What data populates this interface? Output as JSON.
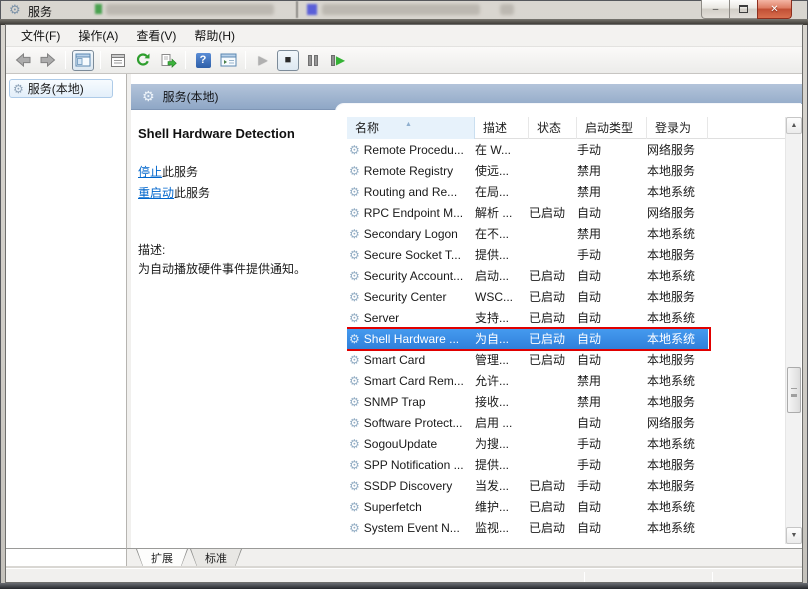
{
  "titlebar": {
    "app_title": "服务"
  },
  "window_controls": {
    "minimize": "–",
    "close": "✕"
  },
  "menubar": {
    "items": [
      "文件(F)",
      "操作(A)",
      "查看(V)",
      "帮助(H)"
    ]
  },
  "toolbar": {
    "icon_names": [
      "back",
      "forward",
      "show-console-tree",
      "properties",
      "refresh",
      "export-list",
      "help",
      "show-action-pane",
      "start-service",
      "stop-service",
      "pause-service",
      "restart-service"
    ],
    "help_glyph": "?"
  },
  "icons": {
    "gear": "⚙",
    "sort_asc": "▲",
    "scroll_up": "▲",
    "scroll_down": "▼",
    "play": "▶",
    "stop": "■",
    "restart_play": "▶"
  },
  "tree": {
    "root_label": "服务(本地)"
  },
  "panel": {
    "header_title": "服务(本地)",
    "service_name": "Shell Hardware Detection",
    "stop_link": "停止",
    "stop_suffix": "此服务",
    "restart_link": "重启动",
    "restart_suffix": "此服务",
    "description_label": "描述:",
    "description_text": "为自动播放硬件事件提供通知。"
  },
  "table": {
    "columns": [
      "名称",
      "描述",
      "状态",
      "启动类型",
      "登录为"
    ],
    "rows": [
      {
        "name": "Remote Procedu...",
        "desc": "在 W...",
        "status": "",
        "startup": "手动",
        "logon": "网络服务",
        "selected": false
      },
      {
        "name": "Remote Registry",
        "desc": "使远...",
        "status": "",
        "startup": "禁用",
        "logon": "本地服务",
        "selected": false
      },
      {
        "name": "Routing and Re...",
        "desc": "在局...",
        "status": "",
        "startup": "禁用",
        "logon": "本地系统",
        "selected": false
      },
      {
        "name": "RPC Endpoint M...",
        "desc": "解析 ...",
        "status": "已启动",
        "startup": "自动",
        "logon": "网络服务",
        "selected": false
      },
      {
        "name": "Secondary Logon",
        "desc": "在不...",
        "status": "",
        "startup": "禁用",
        "logon": "本地系统",
        "selected": false
      },
      {
        "name": "Secure Socket T...",
        "desc": "提供...",
        "status": "",
        "startup": "手动",
        "logon": "本地服务",
        "selected": false
      },
      {
        "name": "Security Account...",
        "desc": "启动...",
        "status": "已启动",
        "startup": "自动",
        "logon": "本地系统",
        "selected": false
      },
      {
        "name": "Security Center",
        "desc": "WSC...",
        "status": "已启动",
        "startup": "自动",
        "logon": "本地服务",
        "selected": false
      },
      {
        "name": "Server",
        "desc": "支持...",
        "status": "已启动",
        "startup": "自动",
        "logon": "本地系统",
        "selected": false
      },
      {
        "name": "Shell Hardware ...",
        "desc": "为自...",
        "status": "已启动",
        "startup": "自动",
        "logon": "本地系统",
        "selected": true
      },
      {
        "name": "Smart Card",
        "desc": "管理...",
        "status": "已启动",
        "startup": "自动",
        "logon": "本地服务",
        "selected": false
      },
      {
        "name": "Smart Card Rem...",
        "desc": "允许...",
        "status": "",
        "startup": "禁用",
        "logon": "本地系统",
        "selected": false
      },
      {
        "name": "SNMP Trap",
        "desc": "接收...",
        "status": "",
        "startup": "禁用",
        "logon": "本地服务",
        "selected": false
      },
      {
        "name": "Software Protect...",
        "desc": "启用 ...",
        "status": "",
        "startup": "自动",
        "logon": "网络服务",
        "selected": false
      },
      {
        "name": "SogouUpdate",
        "desc": "为搜...",
        "status": "",
        "startup": "手动",
        "logon": "本地系统",
        "selected": false
      },
      {
        "name": "SPP Notification ...",
        "desc": "提供...",
        "status": "",
        "startup": "手动",
        "logon": "本地服务",
        "selected": false
      },
      {
        "name": "SSDP Discovery",
        "desc": "当发...",
        "status": "已启动",
        "startup": "手动",
        "logon": "本地服务",
        "selected": false
      },
      {
        "name": "Superfetch",
        "desc": "维护...",
        "status": "已启动",
        "startup": "自动",
        "logon": "本地系统",
        "selected": false
      },
      {
        "name": "System Event N...",
        "desc": "监视...",
        "status": "已启动",
        "startup": "自动",
        "logon": "本地系统",
        "selected": false
      }
    ]
  },
  "bottom_tabs": [
    {
      "label": "扩展",
      "active": true
    },
    {
      "label": "标准",
      "active": false
    }
  ],
  "colors": {
    "selection": "#3c8ae2",
    "highlight_box": "#e10000",
    "link": "#0066cc",
    "band_top": "#b3c4da",
    "band_bottom": "#8fa7c6",
    "header_sorted_bg": "#e7f2fb"
  }
}
